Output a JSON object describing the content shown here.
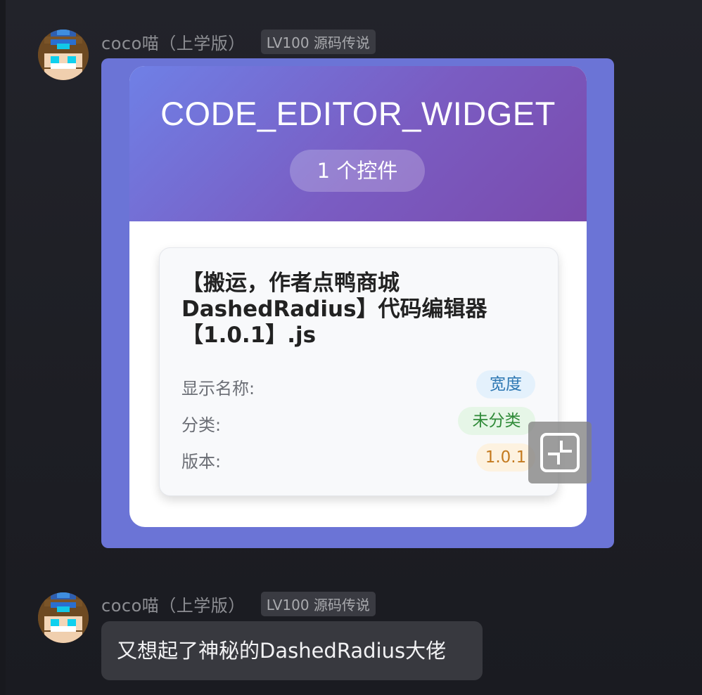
{
  "messages": [
    {
      "sender": "coco喵（上学版）",
      "level_badge": "LV100 源码传说",
      "card": {
        "title": "CODE_EDITOR_WIDGET",
        "count_label": "1 个控件",
        "item": {
          "title": "【搬运，作者点鸭商城DashedRadius】代码编辑器【1.0.1】.js",
          "display_name_label": "显示名称:",
          "display_name_value": "宽度",
          "category_label": "分类:",
          "category_value": "未分类",
          "version_label": "版本:",
          "version_value": "1.0.1"
        }
      }
    },
    {
      "sender": "coco喵（上学版）",
      "level_badge": "LV100 源码传说",
      "text": "又想起了神秘的DashedRadius大佬"
    }
  ],
  "icons": {
    "expand": "expand-icon"
  },
  "colors": {
    "background": "#1f2026",
    "card_bubble": "#6b74d6",
    "header_gradient_start": "#6f80e6",
    "header_gradient_end": "#7a4bad",
    "tag_width_bg": "#e4f1fc",
    "tag_category_bg": "#e6f6e7",
    "tag_version_bg": "#fdf2e0"
  }
}
